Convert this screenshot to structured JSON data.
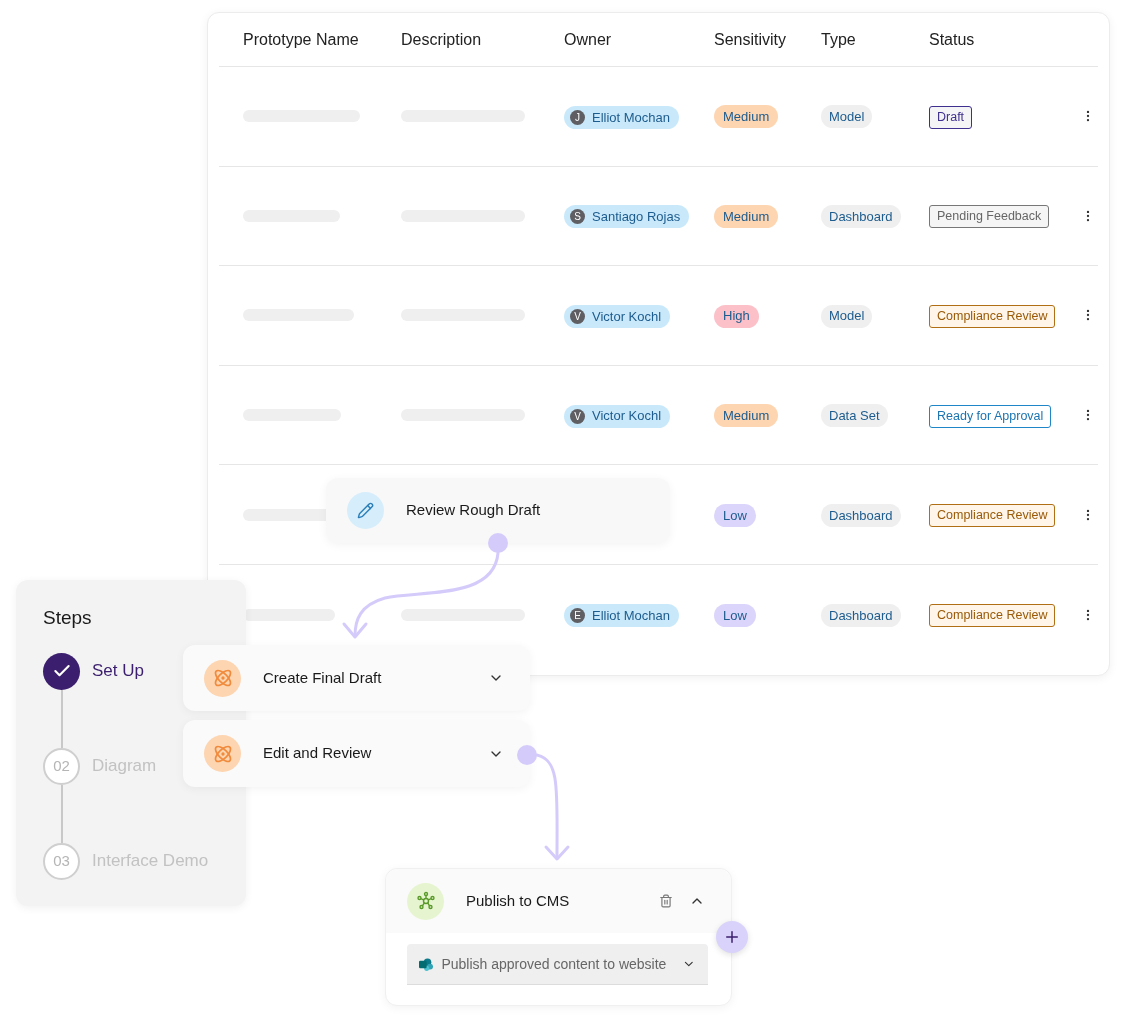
{
  "table": {
    "columns": [
      "Prototype Name",
      "Description",
      "Owner",
      "Sensitivity",
      "Type",
      "Status"
    ],
    "rows": [
      {
        "owner": {
          "initial": "J",
          "name": "Elliot Mochan"
        },
        "sensitivity": {
          "label": "Medium",
          "kind": "medium"
        },
        "type": "Model",
        "status": {
          "label": "Draft",
          "kind": "draft"
        }
      },
      {
        "owner": {
          "initial": "S",
          "name": "Santiago Rojas"
        },
        "sensitivity": {
          "label": "Medium",
          "kind": "medium"
        },
        "type": "Dashboard",
        "status": {
          "label": "Pending Feedback",
          "kind": "pending"
        }
      },
      {
        "owner": {
          "initial": "V",
          "name": "Victor Kochl"
        },
        "sensitivity": {
          "label": "High",
          "kind": "high"
        },
        "type": "Model",
        "status": {
          "label": "Compliance Review",
          "kind": "compliance"
        }
      },
      {
        "owner": {
          "initial": "V",
          "name": "Victor Kochl"
        },
        "sensitivity": {
          "label": "Medium",
          "kind": "medium"
        },
        "type": "Data Set",
        "status": {
          "label": "Ready for Approval",
          "kind": "ready"
        }
      },
      {
        "owner": null,
        "sensitivity": {
          "label": "Low",
          "kind": "low"
        },
        "type": "Dashboard",
        "status": {
          "label": "Compliance Review",
          "kind": "compliance"
        }
      },
      {
        "owner": {
          "initial": "E",
          "name": "Elliot Mochan"
        },
        "sensitivity": {
          "label": "Low",
          "kind": "low"
        },
        "type": "Dashboard",
        "status": {
          "label": "Compliance Review",
          "kind": "compliance"
        }
      }
    ]
  },
  "steps": {
    "title": "Steps",
    "items": [
      {
        "label": "Set Up",
        "done": true,
        "selected": true
      },
      {
        "number": "02",
        "label": "Diagram",
        "done": false,
        "selected": false
      },
      {
        "number": "03",
        "label": "Interface Demo",
        "done": false,
        "selected": false
      }
    ]
  },
  "flow": [
    {
      "title": "Review Rough Draft",
      "kind": "edit"
    },
    {
      "title": "Create Final Draft",
      "kind": "atom",
      "expanded": false
    },
    {
      "title": "Edit and Review",
      "kind": "atom",
      "expanded": false
    },
    {
      "title": "Publish to CMS",
      "kind": "network",
      "expanded": true,
      "action": "Publish approved content to website"
    }
  ]
}
